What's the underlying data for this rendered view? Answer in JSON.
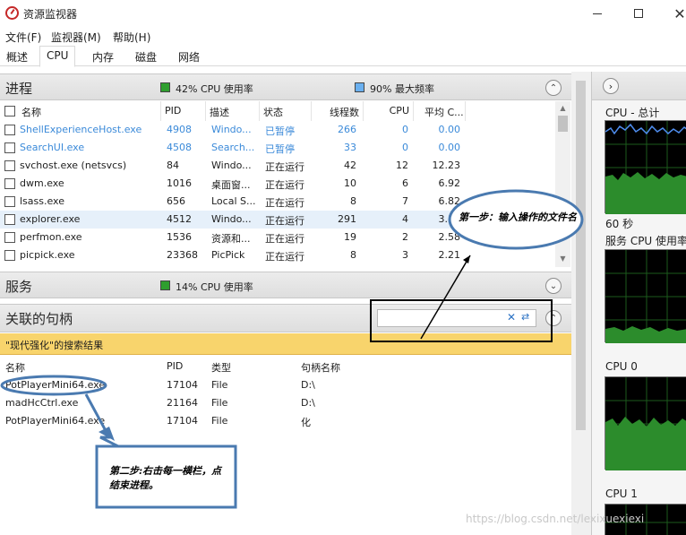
{
  "window": {
    "title": "资源监视器",
    "min_label": "",
    "close_label": "✕"
  },
  "menu": [
    "文件(F)",
    "监视器(M)",
    "帮助(H)"
  ],
  "tabs": [
    "概述",
    "CPU",
    "内存",
    "磁盘",
    "网络"
  ],
  "active_tab": "CPU",
  "colors": {
    "accent_green": "#2e9e2e",
    "accent_blue": "#3b8ad9",
    "result_bar": "#f8d46c",
    "annotation_blue": "#4a7ab0"
  },
  "processes": {
    "title": "进程",
    "cpu_usage": "42% CPU 使用率",
    "max_freq": "90% 最大频率",
    "columns": [
      "名称",
      "PID",
      "描述",
      "状态",
      "线程数",
      "CPU",
      "平均 C..."
    ],
    "rows": [
      {
        "name": "ShellExperienceHost.exe",
        "pid": "4908",
        "desc": "Windo...",
        "status": "已暂停",
        "threads": "266",
        "cpu": "0",
        "avg": "0.00",
        "suspended": true
      },
      {
        "name": "SearchUI.exe",
        "pid": "4508",
        "desc": "Search...",
        "status": "已暂停",
        "threads": "33",
        "cpu": "0",
        "avg": "0.00",
        "suspended": true
      },
      {
        "name": "svchost.exe (netsvcs)",
        "pid": "84",
        "desc": "Windo...",
        "status": "正在运行",
        "threads": "42",
        "cpu": "12",
        "avg": "12.23"
      },
      {
        "name": "dwm.exe",
        "pid": "1016",
        "desc": "桌面窗...",
        "status": "正在运行",
        "threads": "10",
        "cpu": "6",
        "avg": "6.92"
      },
      {
        "name": "lsass.exe",
        "pid": "656",
        "desc": "Local S...",
        "status": "正在运行",
        "threads": "8",
        "cpu": "7",
        "avg": "6.82"
      },
      {
        "name": "explorer.exe",
        "pid": "4512",
        "desc": "Windo...",
        "status": "正在运行",
        "threads": "291",
        "cpu": "4",
        "avg": "3.13",
        "selected": true
      },
      {
        "name": "perfmon.exe",
        "pid": "1536",
        "desc": "资源和...",
        "status": "正在运行",
        "threads": "19",
        "cpu": "2",
        "avg": "2.58"
      },
      {
        "name": "picpick.exe",
        "pid": "23368",
        "desc": "PicPick",
        "status": "正在运行",
        "threads": "8",
        "cpu": "3",
        "avg": "2.21"
      }
    ]
  },
  "services": {
    "title": "服务",
    "cpu_usage": "14% CPU 使用率"
  },
  "handles": {
    "title": "关联的句柄",
    "search_value": "",
    "result_text": "\"现代强化\"的搜索结果",
    "columns": [
      "名称",
      "PID",
      "类型",
      "句柄名称"
    ],
    "rows": [
      {
        "name": "PotPlayerMini64.exe",
        "pid": "17104",
        "type": "File",
        "handle": "D:\\"
      },
      {
        "name": "madHcCtrl.exe",
        "pid": "21164",
        "type": "File",
        "handle": "D:\\"
      },
      {
        "name": "PotPlayerMini64.exe",
        "pid": "17104",
        "type": "File",
        "handle": "化"
      }
    ]
  },
  "right_pane": {
    "cpu_total": "CPU - 总计",
    "seconds": "60 秒",
    "service_cpu": "服务 CPU 使用率",
    "cpu0": "CPU 0",
    "cpu1": "CPU 1"
  },
  "annotations": {
    "step1": "第一步：输入操作的文件名",
    "step2": "第二步:右击每一横栏，点结束进程。"
  },
  "watermark": "https://blog.csdn.net/lexixuexiexi"
}
